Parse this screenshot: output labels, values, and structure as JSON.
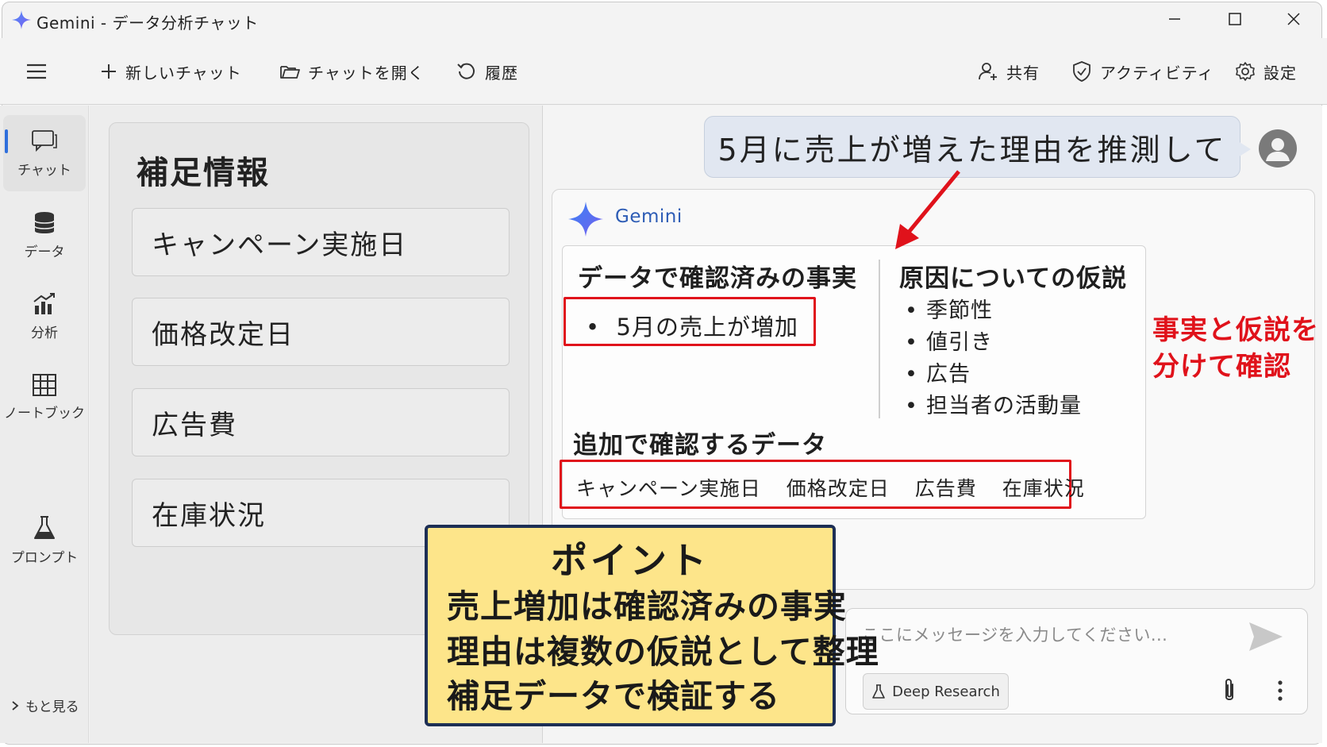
{
  "window": {
    "title": "Gemini - データ分析チャット"
  },
  "toolbar": {
    "new_chat": "新しいチャット",
    "open_chat": "チャットを開く",
    "history": "履歴",
    "share": "共有",
    "activity": "アクティビティ",
    "settings": "設定"
  },
  "rail": {
    "items": [
      {
        "label": "チャット",
        "icon": "chat-icon",
        "active": true
      },
      {
        "label": "データ",
        "icon": "database-icon"
      },
      {
        "label": "分析",
        "icon": "chart-icon"
      },
      {
        "label": "ノートブック",
        "icon": "table-icon"
      },
      {
        "label": "プロンプト",
        "icon": "flask-icon"
      }
    ],
    "more": "もと見る"
  },
  "supplement": {
    "title": "補足情報",
    "items": [
      "キャンペーン実施日",
      "価格改定日",
      "広告費",
      "在庫状況"
    ]
  },
  "chat": {
    "user_message": "5月に売上が増えた理由を推測して",
    "assistant_name": "Gemini",
    "facts_title": "データで確認済みの事実",
    "facts": [
      "5月の売上が増加"
    ],
    "hypotheses_title": "原因についての仮説",
    "hypotheses": [
      "季節性",
      "値引き",
      "広告",
      "担当者の活動量"
    ],
    "additional_title": "追加で確認するデータ",
    "additional": [
      "キャンペーン実施日",
      "価格改定日",
      "広告費",
      "在庫状況"
    ],
    "side_note_lines": [
      "事実と仮説を",
      "分けて確認"
    ]
  },
  "input": {
    "placeholder": "ここにメッセージを入力してください...",
    "deep_research": "Deep Research"
  },
  "point": {
    "title": "ポイント",
    "lines": [
      "売上増加は確認済みの事実",
      "理由は複数の仮説として整理",
      "補足データで検証する"
    ]
  },
  "colors": {
    "accent_red": "#e0121b",
    "gemini_blue": "#2d5cb5",
    "point_bg": "#fde58a",
    "point_border": "#1d2f55",
    "user_bubble": "#e1e7f1"
  }
}
